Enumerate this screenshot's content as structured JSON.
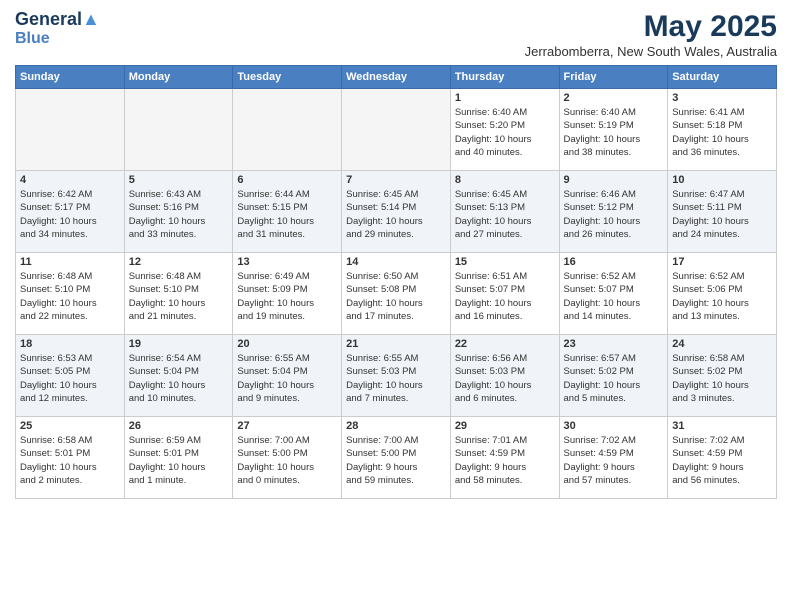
{
  "header": {
    "logo_line1": "General",
    "logo_line2": "Blue",
    "month_title": "May 2025",
    "location": "Jerrabomberra, New South Wales, Australia"
  },
  "weekdays": [
    "Sunday",
    "Monday",
    "Tuesday",
    "Wednesday",
    "Thursday",
    "Friday",
    "Saturday"
  ],
  "weeks": [
    [
      {
        "day": "",
        "info": ""
      },
      {
        "day": "",
        "info": ""
      },
      {
        "day": "",
        "info": ""
      },
      {
        "day": "",
        "info": ""
      },
      {
        "day": "1",
        "info": "Sunrise: 6:40 AM\nSunset: 5:20 PM\nDaylight: 10 hours\nand 40 minutes."
      },
      {
        "day": "2",
        "info": "Sunrise: 6:40 AM\nSunset: 5:19 PM\nDaylight: 10 hours\nand 38 minutes."
      },
      {
        "day": "3",
        "info": "Sunrise: 6:41 AM\nSunset: 5:18 PM\nDaylight: 10 hours\nand 36 minutes."
      }
    ],
    [
      {
        "day": "4",
        "info": "Sunrise: 6:42 AM\nSunset: 5:17 PM\nDaylight: 10 hours\nand 34 minutes."
      },
      {
        "day": "5",
        "info": "Sunrise: 6:43 AM\nSunset: 5:16 PM\nDaylight: 10 hours\nand 33 minutes."
      },
      {
        "day": "6",
        "info": "Sunrise: 6:44 AM\nSunset: 5:15 PM\nDaylight: 10 hours\nand 31 minutes."
      },
      {
        "day": "7",
        "info": "Sunrise: 6:45 AM\nSunset: 5:14 PM\nDaylight: 10 hours\nand 29 minutes."
      },
      {
        "day": "8",
        "info": "Sunrise: 6:45 AM\nSunset: 5:13 PM\nDaylight: 10 hours\nand 27 minutes."
      },
      {
        "day": "9",
        "info": "Sunrise: 6:46 AM\nSunset: 5:12 PM\nDaylight: 10 hours\nand 26 minutes."
      },
      {
        "day": "10",
        "info": "Sunrise: 6:47 AM\nSunset: 5:11 PM\nDaylight: 10 hours\nand 24 minutes."
      }
    ],
    [
      {
        "day": "11",
        "info": "Sunrise: 6:48 AM\nSunset: 5:10 PM\nDaylight: 10 hours\nand 22 minutes."
      },
      {
        "day": "12",
        "info": "Sunrise: 6:48 AM\nSunset: 5:10 PM\nDaylight: 10 hours\nand 21 minutes."
      },
      {
        "day": "13",
        "info": "Sunrise: 6:49 AM\nSunset: 5:09 PM\nDaylight: 10 hours\nand 19 minutes."
      },
      {
        "day": "14",
        "info": "Sunrise: 6:50 AM\nSunset: 5:08 PM\nDaylight: 10 hours\nand 17 minutes."
      },
      {
        "day": "15",
        "info": "Sunrise: 6:51 AM\nSunset: 5:07 PM\nDaylight: 10 hours\nand 16 minutes."
      },
      {
        "day": "16",
        "info": "Sunrise: 6:52 AM\nSunset: 5:07 PM\nDaylight: 10 hours\nand 14 minutes."
      },
      {
        "day": "17",
        "info": "Sunrise: 6:52 AM\nSunset: 5:06 PM\nDaylight: 10 hours\nand 13 minutes."
      }
    ],
    [
      {
        "day": "18",
        "info": "Sunrise: 6:53 AM\nSunset: 5:05 PM\nDaylight: 10 hours\nand 12 minutes."
      },
      {
        "day": "19",
        "info": "Sunrise: 6:54 AM\nSunset: 5:04 PM\nDaylight: 10 hours\nand 10 minutes."
      },
      {
        "day": "20",
        "info": "Sunrise: 6:55 AM\nSunset: 5:04 PM\nDaylight: 10 hours\nand 9 minutes."
      },
      {
        "day": "21",
        "info": "Sunrise: 6:55 AM\nSunset: 5:03 PM\nDaylight: 10 hours\nand 7 minutes."
      },
      {
        "day": "22",
        "info": "Sunrise: 6:56 AM\nSunset: 5:03 PM\nDaylight: 10 hours\nand 6 minutes."
      },
      {
        "day": "23",
        "info": "Sunrise: 6:57 AM\nSunset: 5:02 PM\nDaylight: 10 hours\nand 5 minutes."
      },
      {
        "day": "24",
        "info": "Sunrise: 6:58 AM\nSunset: 5:02 PM\nDaylight: 10 hours\nand 3 minutes."
      }
    ],
    [
      {
        "day": "25",
        "info": "Sunrise: 6:58 AM\nSunset: 5:01 PM\nDaylight: 10 hours\nand 2 minutes."
      },
      {
        "day": "26",
        "info": "Sunrise: 6:59 AM\nSunset: 5:01 PM\nDaylight: 10 hours\nand 1 minute."
      },
      {
        "day": "27",
        "info": "Sunrise: 7:00 AM\nSunset: 5:00 PM\nDaylight: 10 hours\nand 0 minutes."
      },
      {
        "day": "28",
        "info": "Sunrise: 7:00 AM\nSunset: 5:00 PM\nDaylight: 9 hours\nand 59 minutes."
      },
      {
        "day": "29",
        "info": "Sunrise: 7:01 AM\nSunset: 4:59 PM\nDaylight: 9 hours\nand 58 minutes."
      },
      {
        "day": "30",
        "info": "Sunrise: 7:02 AM\nSunset: 4:59 PM\nDaylight: 9 hours\nand 57 minutes."
      },
      {
        "day": "31",
        "info": "Sunrise: 7:02 AM\nSunset: 4:59 PM\nDaylight: 9 hours\nand 56 minutes."
      }
    ]
  ]
}
